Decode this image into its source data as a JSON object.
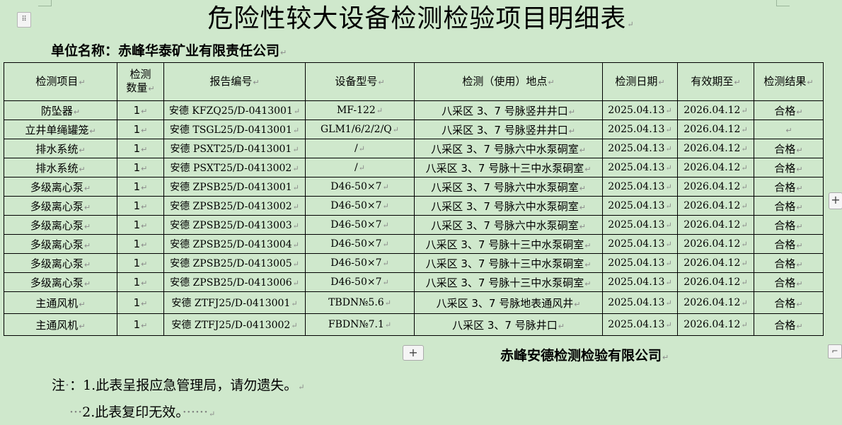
{
  "title": "危险性较大设备检测检验项目明细表",
  "unit_label": "单位名称：赤峰华泰矿业有限责任公司",
  "columns": [
    "检测项目",
    "检测\n数量",
    "报告编号",
    "设备型号",
    "检测（使用）地点",
    "检测日期",
    "有效期至",
    "检测结果"
  ],
  "rows": [
    [
      "防坠器",
      "1",
      "安德 KFZQ25/D-0413001",
      "MF-122",
      "八采区 3、7 号脉竖井井口",
      "2025.04.13",
      "2026.04.12",
      "合格"
    ],
    [
      "立井单绳罐笼",
      "1",
      "安德 TSGL25/D-0413001",
      "GLM1/6/2/2/Q",
      "八采区 3、7 号脉竖井井口",
      "2025.04.13",
      "2026.04.12",
      ""
    ],
    [
      "排水系统",
      "1",
      "安德 PSXT25/D-0413001",
      "/",
      "八采区 3、7 号脉六中水泵硐室",
      "2025.04.13",
      "2026.04.12",
      "合格"
    ],
    [
      "排水系统",
      "1",
      "安德 PSXT25/D-0413002",
      "/",
      "八采区 3、7 号脉十三中水泵硐室",
      "2025.04.13",
      "2026.04.12",
      "合格"
    ],
    [
      "多级离心泵",
      "1",
      "安德 ZPSB25/D-0413001",
      "D46-50×7",
      "八采区 3、7 号脉六中水泵硐室",
      "2025.04.13",
      "2026.04.12",
      "合格"
    ],
    [
      "多级离心泵",
      "1",
      "安德 ZPSB25/D-0413002",
      "D46-50×7",
      "八采区 3、7 号脉六中水泵硐室",
      "2025.04.13",
      "2026.04.12",
      "合格"
    ],
    [
      "多级离心泵",
      "1",
      "安德 ZPSB25/D-0413003",
      "D46-50×7",
      "八采区 3、7 号脉六中水泵硐室",
      "2025.04.13",
      "2026.04.12",
      "合格"
    ],
    [
      "多级离心泵",
      "1",
      "安德 ZPSB25/D-0413004",
      "D46-50×7",
      "八采区 3、7 号脉十三中水泵硐室",
      "2025.04.13",
      "2026.04.12",
      "合格"
    ],
    [
      "多级离心泵",
      "1",
      "安德 ZPSB25/D-0413005",
      "D46-50×7",
      "八采区 3、7 号脉十三中水泵硐室",
      "2025.04.13",
      "2026.04.12",
      "合格"
    ],
    [
      "多级离心泵",
      "1",
      "安德 ZPSB25/D-0413006",
      "D46-50×7",
      "八采区 3、7 号脉十三中水泵硐室",
      "2025.04.13",
      "2026.04.12",
      "合格"
    ],
    [
      "主通风机",
      "1",
      "安德 ZTFJ25/D-0413001",
      "TBDN№5.6",
      "八采区 3、7 号脉地表通风井",
      "2025.04.13",
      "2026.04.12",
      "合格"
    ],
    [
      "主通风机",
      "1",
      "安德 ZTFJ25/D-0413002",
      "FBDN№7.1",
      "八采区 3、7 号脉井口",
      "2025.04.13",
      "2026.04.12",
      "合格"
    ]
  ],
  "company": "赤峰安德检测检验有限公司",
  "note_prefix": "注",
  "note1": "：1.此表呈报应急管理局，请勿遗失。",
  "note2": "2.此表复印无效。",
  "paragraph_mark": "↵",
  "move_handle_icon": "⠿",
  "add_icon": "+",
  "resize_icon": "⌐"
}
